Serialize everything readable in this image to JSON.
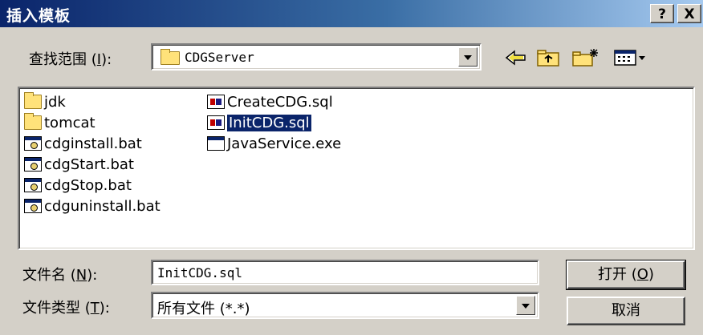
{
  "window": {
    "title": "插入模板",
    "help_label": "?",
    "close_label": "X"
  },
  "lookin": {
    "label": "查找范围",
    "accel": "I",
    "value": "CDGServer",
    "icon": "folder-icon"
  },
  "toolbar": {
    "back_icon": "back-arrow-icon",
    "up_icon": "up-folder-icon",
    "newfolder_icon": "new-folder-icon",
    "view_icon": "view-menu-icon"
  },
  "files": [
    {
      "name": "jdk",
      "icon": "folder-icon"
    },
    {
      "name": "tomcat",
      "icon": "folder-icon"
    },
    {
      "name": "cdginstall.bat",
      "icon": "batch-file-icon"
    },
    {
      "name": "cdgStart.bat",
      "icon": "batch-file-icon"
    },
    {
      "name": "cdgStop.bat",
      "icon": "batch-file-icon"
    },
    {
      "name": "cdguninstall.bat",
      "icon": "batch-file-icon"
    },
    {
      "name": "CreateCDG.sql",
      "icon": "sql-file-icon"
    },
    {
      "name": "InitCDG.sql",
      "icon": "sql-file-icon",
      "selected": true
    },
    {
      "name": "JavaService.exe",
      "icon": "exe-file-icon"
    }
  ],
  "filename": {
    "label": "文件名",
    "accel": "N",
    "value": "InitCDG.sql"
  },
  "filetype": {
    "label": "文件类型",
    "accel": "T",
    "value": "所有文件 (*.*)"
  },
  "buttons": {
    "open_label": "打开",
    "open_accel": "O",
    "cancel_label": "取消"
  },
  "colors": {
    "title_start": "#0a246a",
    "title_end": "#a6caf0",
    "face": "#d4d0c8",
    "selection": "#0a246a"
  }
}
